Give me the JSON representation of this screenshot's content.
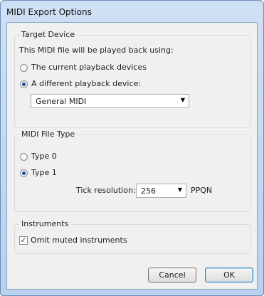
{
  "window": {
    "title": "MIDI Export Options"
  },
  "target_device": {
    "legend": "Target Device",
    "description": "This MIDI file will be played back using:",
    "option_current": "The current playback devices",
    "option_different": "A different playback device:",
    "selected_option": "A different playback device:",
    "device_value": "General MIDI"
  },
  "file_type": {
    "legend": "MIDI File Type",
    "option_type0": "Type 0",
    "option_type1": "Type 1",
    "selected_option": "Type 1",
    "tick_label": "Tick resolution:",
    "tick_value": "256",
    "tick_unit": "PPQN"
  },
  "instruments": {
    "legend": "Instruments",
    "omit_muted_label": "Omit muted instruments",
    "omit_muted_checked": true
  },
  "buttons": {
    "cancel": "Cancel",
    "ok": "OK"
  },
  "icons": {
    "dropdown": "chevron-down-icon",
    "check": "checkmark-icon"
  }
}
